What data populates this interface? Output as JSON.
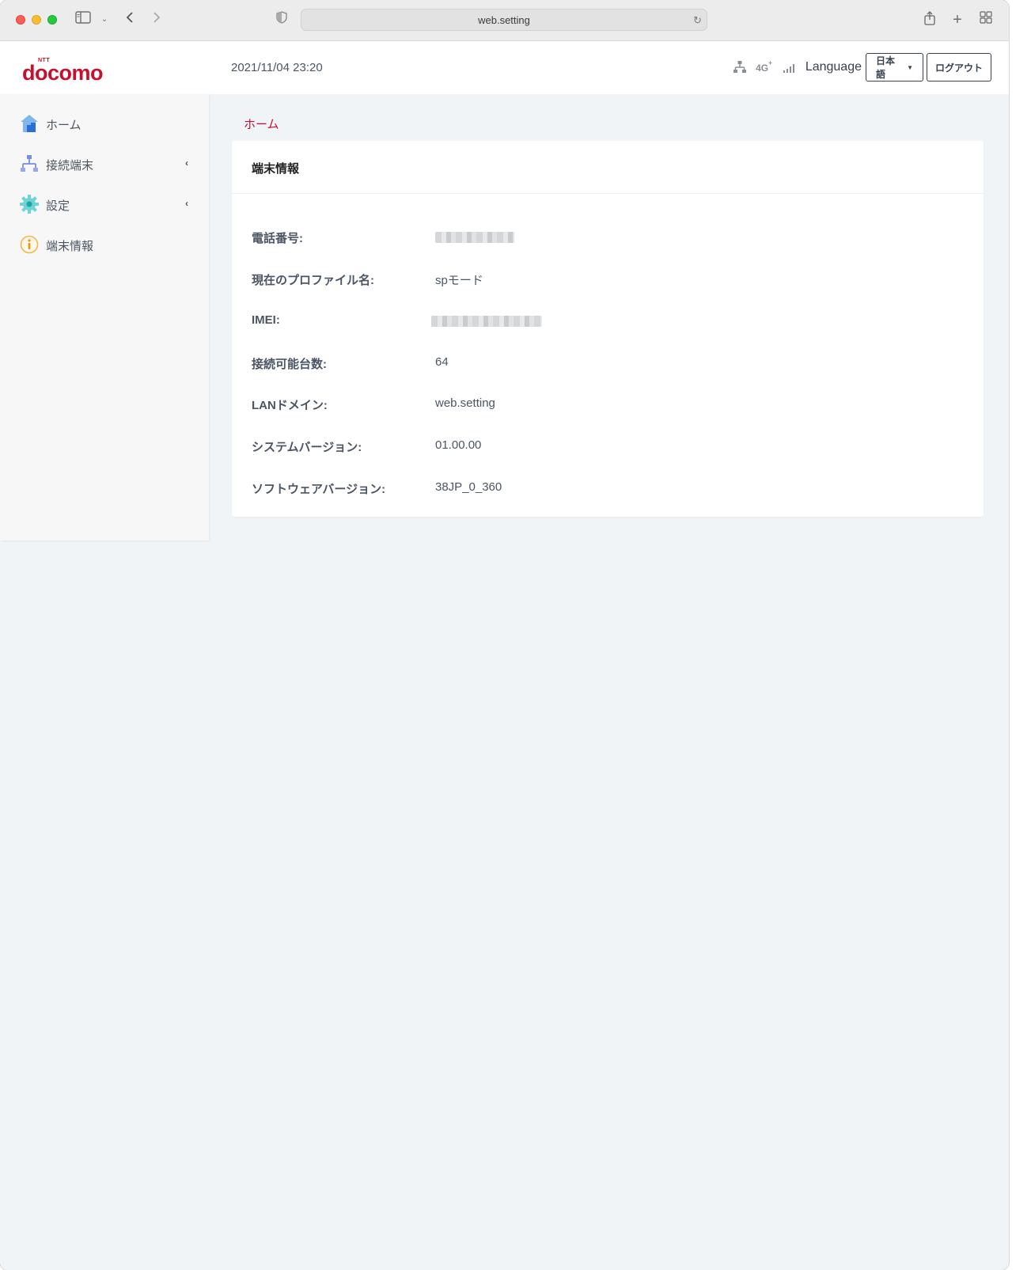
{
  "browser": {
    "address": "web.setting"
  },
  "header": {
    "brand_small": "NTT",
    "brand": "docomo",
    "datetime": "2021/11/04 23:20",
    "network_type": "4G",
    "network_sup": "+",
    "language_label": "Language",
    "language_value": "日本語",
    "logout_label": "ログアウト"
  },
  "sidebar": {
    "items": [
      {
        "label": "ホーム",
        "icon": "home-icon",
        "has_submenu": false
      },
      {
        "label": "接続端末",
        "icon": "network-devices-icon",
        "has_submenu": true
      },
      {
        "label": "設定",
        "icon": "gear-icon",
        "has_submenu": true
      },
      {
        "label": "端末情報",
        "icon": "info-icon",
        "has_submenu": false
      }
    ]
  },
  "breadcrumb": "ホーム",
  "card": {
    "title": "端末情報",
    "rows": [
      {
        "key": "電話番号:",
        "value": "",
        "redacted": true
      },
      {
        "key": "現在のプロファイル名:",
        "value": "spモード"
      },
      {
        "key": "IMEI:",
        "value": "",
        "redacted": true
      },
      {
        "key": "接続可能台数:",
        "value": "64"
      },
      {
        "key": "LANドメイン:",
        "value": "web.setting"
      },
      {
        "key": "システムバージョン:",
        "value": "01.00.00"
      },
      {
        "key": "ソフトウェアバージョン:",
        "value": "38JP_0_360"
      }
    ]
  },
  "colors": {
    "brand_red": "#c8102e",
    "text_gray": "#4b5563",
    "page_bg": "#f1f4f7"
  }
}
